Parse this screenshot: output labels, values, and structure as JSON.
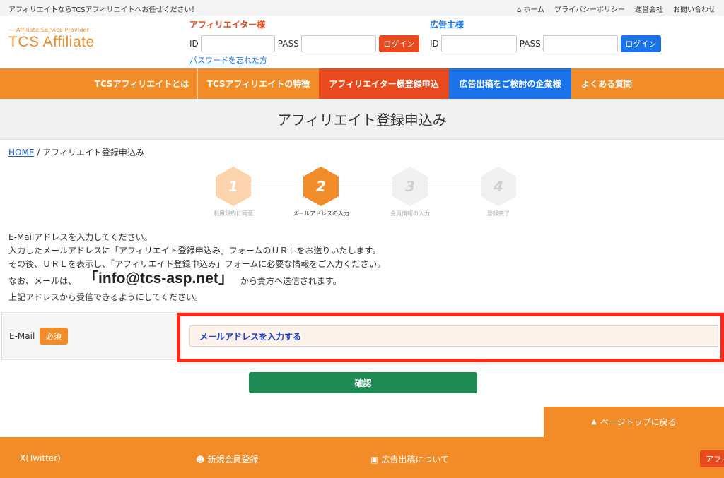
{
  "topbar": {
    "tagline": "アフィリエイトならTCSアフィリエイトへお任せください！",
    "links": {
      "home": "ホーム",
      "privacy": "プライバシーポリシー",
      "company": "運営会社",
      "contact": "お問い合わせ"
    },
    "home_icon": "home-icon"
  },
  "logo": {
    "sub": "— Affiliate Service Provider —",
    "main": "TCS Affiliate"
  },
  "affiliate_login": {
    "title": "アフィリエイター様",
    "id_label": "ID",
    "id_value": "",
    "pass_label": "PASS",
    "pass_value": "",
    "button": "ログイン",
    "forgot": "パスワードを忘れた方"
  },
  "advertiser_login": {
    "title": "広告主様",
    "id_label": "ID",
    "id_value": "",
    "pass_label": "PASS",
    "pass_value": "",
    "button": "ログイン"
  },
  "nav": {
    "items": [
      "TCSアフィリエイトとは",
      "TCSアフィリエイトの特徴",
      "アフィリエイター様登録申込",
      "広告出稿をご検討の企業様",
      "よくある質問"
    ]
  },
  "page_title": "アフィリエイト登録申込み",
  "breadcrumb": {
    "home": "HOME",
    "separator": "/",
    "current": "アフィリエイト登録申込み"
  },
  "steps": [
    {
      "num": "1",
      "label": "利用規約に同意",
      "state": "done"
    },
    {
      "num": "2",
      "label": "メールアドレスの入力",
      "state": "active"
    },
    {
      "num": "3",
      "label": "会員情報の入力",
      "state": "todo"
    },
    {
      "num": "4",
      "label": "登録完了",
      "state": "todo"
    }
  ],
  "intro": {
    "line1": "E-Mailアドレスを入力してください。",
    "line2": "入力したメールアドレスに「アフィリエイト登録申込み」フォームのＵＲＬをお送りいたします。",
    "line3": "その後、ＵＲＬを表示し、「アフィリエイト登録申込み」フォームに必要な情報をご入力ください。",
    "line4_prefix": "なお、メールは、",
    "address": "「info@tcs-asp.net」",
    "line4_suffix": "から貴方へ送信されます。",
    "line5": "上記アドレスから受信できるようにしてください。"
  },
  "form": {
    "label": "E-Mail",
    "required_badge": "必須",
    "placeholder": "メールアドレスを入力する",
    "value": ""
  },
  "confirm_button": "確認",
  "page_top": "ページトップに戻る",
  "footer": {
    "twitter": "X(Twitter)",
    "signup": "新規会員登録",
    "ads": "広告出稿について",
    "affiliate_tag": "アフィリエイター様"
  },
  "colors": {
    "brand_orange": "#f28c28",
    "affiliate_red": "#e8491d",
    "advertiser_blue": "#1a73e8",
    "confirm_green": "#1e8a54",
    "highlight_red": "#ff2a1a"
  }
}
